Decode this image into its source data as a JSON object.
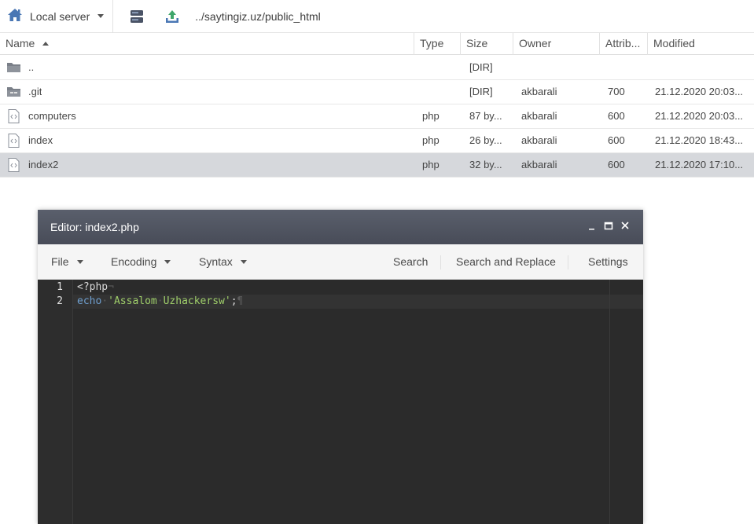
{
  "toolbar": {
    "server_label": "Local server",
    "path": "../saytingiz.uz/public_html",
    "icons": [
      "home-icon",
      "drive-icon",
      "upload-icon"
    ]
  },
  "columns": {
    "name": "Name",
    "type": "Type",
    "size": "Size",
    "owner": "Owner",
    "attrib": "Attrib...",
    "modified": "Modified"
  },
  "files": [
    {
      "name": "..",
      "type": "",
      "size": "[DIR]",
      "owner": "",
      "attrib": "",
      "modified": "",
      "icon": "folder-icon"
    },
    {
      "name": ".git",
      "type": "",
      "size": "[DIR]",
      "owner": "akbarali",
      "attrib": "700",
      "modified": "21.12.2020 20:03...",
      "icon": "git-folder-icon"
    },
    {
      "name": "computers",
      "type": "php",
      "size": "87 by...",
      "owner": "akbarali",
      "attrib": "600",
      "modified": "21.12.2020 20:03...",
      "icon": "code-file-icon"
    },
    {
      "name": "index",
      "type": "php",
      "size": "26 by...",
      "owner": "akbarali",
      "attrib": "600",
      "modified": "21.12.2020 18:43...",
      "icon": "code-file-icon"
    },
    {
      "name": "index2",
      "type": "php",
      "size": "32 by...",
      "owner": "akbarali",
      "attrib": "600",
      "modified": "21.12.2020 17:10...",
      "icon": "code-file-icon",
      "selected": true
    }
  ],
  "editor": {
    "title": "Editor: index2.php",
    "menu": {
      "file": "File",
      "encoding": "Encoding",
      "syntax": "Syntax",
      "search": "Search",
      "search_replace": "Search and Replace",
      "settings": "Settings"
    },
    "lines": [
      {
        "num": "1",
        "open_tag": "<?php",
        "eol": "¬"
      },
      {
        "num": "2",
        "keyword": "echo",
        "dot": "·",
        "string_open": "'Assalom",
        "dot2": "·",
        "string_close": "Uzhackersw'",
        "semicolon": ";",
        "eol": "¶"
      }
    ]
  },
  "colors": {
    "selected_row": "#d6d8dc",
    "editor_bg": "#2b2b2b",
    "keyword": "#6f9fcf",
    "string": "#9fce6a"
  }
}
